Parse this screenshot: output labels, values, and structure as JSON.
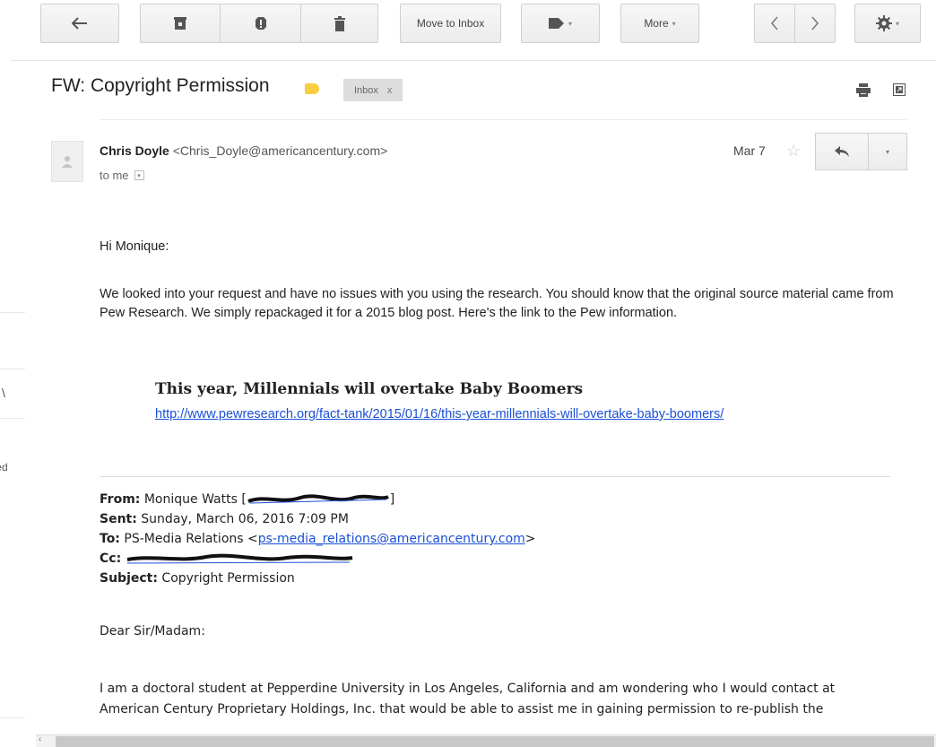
{
  "toolbar": {
    "move_to_inbox": "Move to Inbox",
    "more": "More",
    "caret": "▾"
  },
  "email": {
    "subject": "FW: Copyright Permission",
    "label": "Inbox",
    "label_remove": "x",
    "sender_name": "Chris Doyle",
    "sender_email": "<Chris_Doyle@americancentury.com>",
    "recipient": "to me",
    "date": "Mar 7",
    "greeting": "Hi Monique:",
    "paragraph1": "We looked into your request and have no issues with you using the research. You should know that the original source material came from Pew Research.  We simply repackaged it for a 2015 blog post.  Here's the link to the Pew information.",
    "link_title": "This year, Millennials will overtake Baby Boomers",
    "link_url": "http://www.pewresearch.org/fact-tank/2015/01/16/this-year-millennials-will-overtake-baby-boomers/"
  },
  "forwarded": {
    "from_label": "From:",
    "from_name": "Monique Watts [",
    "from_suffix": "]",
    "sent_label": "Sent:",
    "sent_value": "Sunday, March 06, 2016 7:09 PM",
    "to_label": "To:",
    "to_name": "PS-Media Relations <",
    "to_email": "ps-media_relations@americancentury.com",
    "to_suffix": ">",
    "cc_label": "Cc:",
    "subject_label": "Subject:",
    "subject_value": "Copyright Permission",
    "salutation": "Dear Sir/Madam:",
    "body_line1": "I am a doctoral student at Pepperdine University in Los Angeles, California and am wondering who I would contact at",
    "body_line2": "American Century Proprietary Holdings, Inc. that would be able to assist me in gaining permission to re-publish the"
  },
  "sidebar_fragments": {
    "search_glyph": "\\",
    "label_fragment": "ted"
  },
  "colors": {
    "link": "#1a4fd6",
    "label_tag": "#f8cd3f"
  }
}
